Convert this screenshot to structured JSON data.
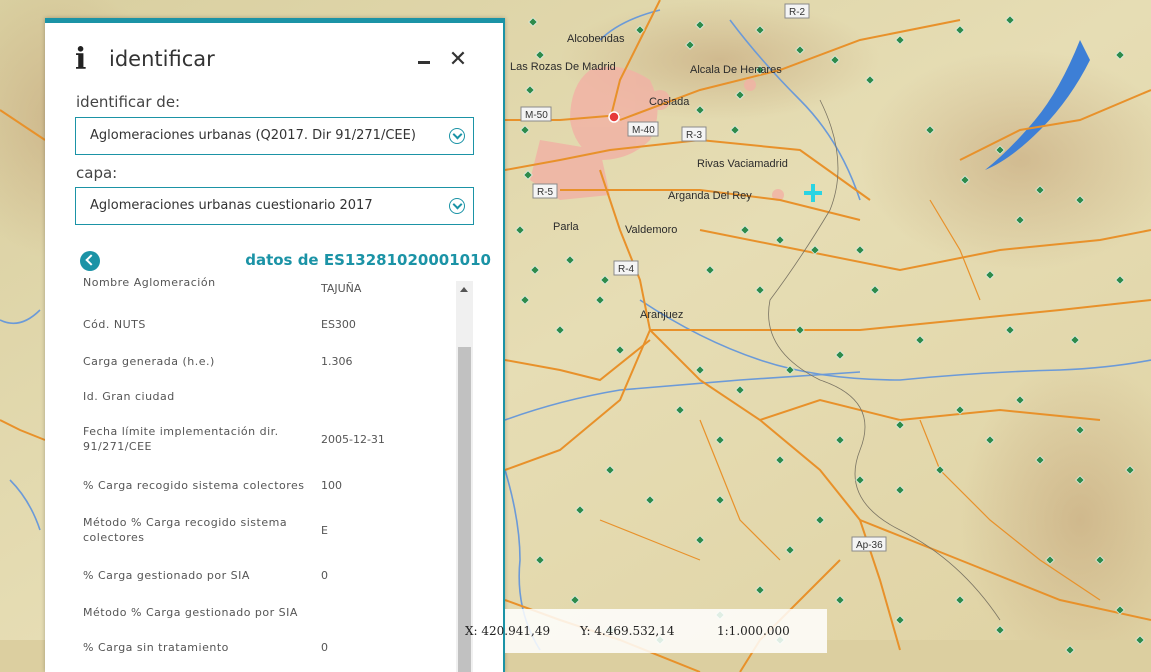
{
  "map": {
    "places": [
      "Alcobendas",
      "Las Rozas De Madrid",
      "Alcala De Henares",
      "Coslada",
      "Rivas Vaciamadrid",
      "Arganda Del Rey",
      "Parla",
      "Valdemoro",
      "Aranjuez"
    ],
    "roads": [
      "M-50",
      "M-40",
      "R-3",
      "R-5",
      "R-4",
      "Ap-36",
      "R-2"
    ],
    "colors": {
      "accent": "#1b93a6",
      "roads": "#e8912a",
      "rivers": "#5a8fd4",
      "urban": "#f3a9a0",
      "lakes": "#3d7fd6",
      "points": "#1f6e3a"
    }
  },
  "panel": {
    "title": "identificar",
    "icon": "info-icon",
    "identify_from_label": "identificar de:",
    "identify_from_value": "Aglomeraciones urbanas (Q2017. Dir 91/271/CEE)",
    "layer_label": "capa:",
    "layer_value": "Aglomeraciones urbanas cuestionario 2017",
    "datos_title": "datos de ES13281020001010",
    "attributes": [
      {
        "key": "Nombre Aglomeración",
        "value": "TAJUÑA"
      },
      {
        "key": "Cód. NUTS",
        "value": "ES300"
      },
      {
        "key": "Carga generada (h.e.)",
        "value": "1.306"
      },
      {
        "key": "Id. Gran ciudad",
        "value": ""
      },
      {
        "key": "Fecha límite implementación dir. 91/271/CEE",
        "value": "2005-12-31"
      },
      {
        "key": "% Carga recogido sistema colectores",
        "value": "100"
      },
      {
        "key": "Método % Carga recogido sistema colectores",
        "value": "E"
      },
      {
        "key": "% Carga gestionado por SIA",
        "value": "0"
      },
      {
        "key": "Método % Carga gestionado por SIA",
        "value": ""
      },
      {
        "key": "% Carga sin tratamiento",
        "value": "0"
      }
    ]
  },
  "coords": {
    "x": "X: 420.941,49",
    "y": "Y: 4.469.532,14",
    "scale": "1:1.000.000"
  }
}
